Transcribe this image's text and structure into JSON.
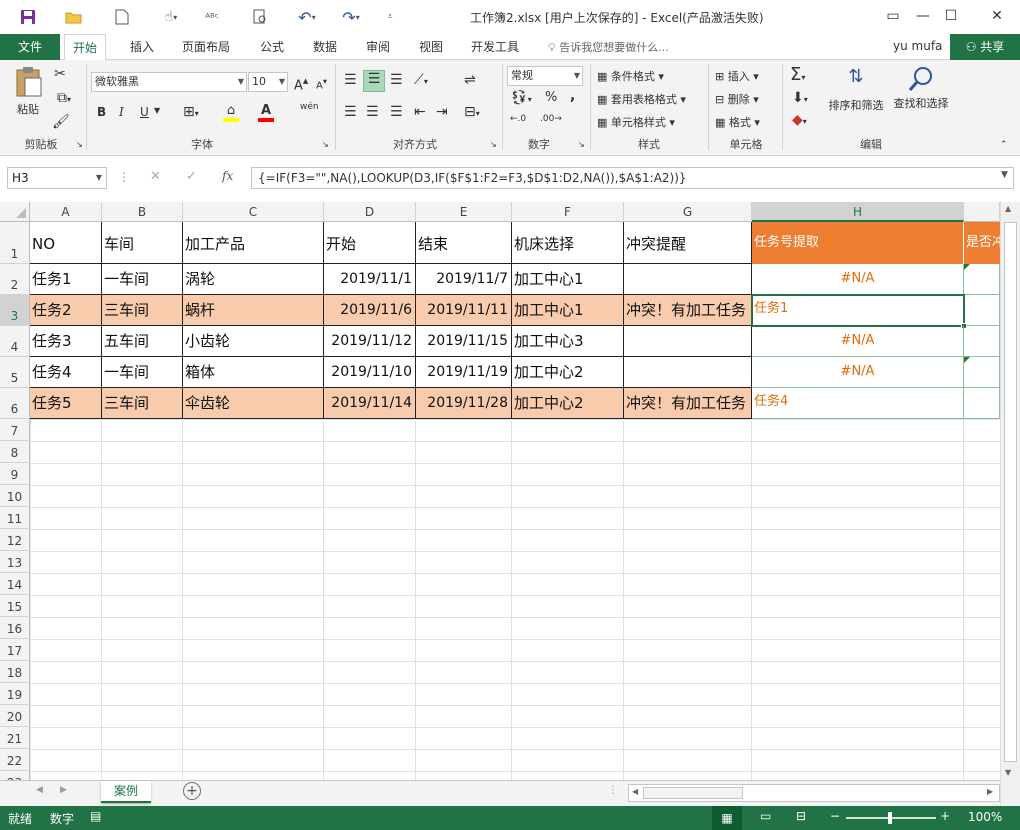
{
  "window": {
    "title": "工作簿2.xlsx [用户上次保存的] - Excel(产品激活失败)",
    "controls": [
      "restore-icon",
      "minimize-icon",
      "maximize-icon",
      "close-icon"
    ]
  },
  "tabs": {
    "file": "文件",
    "items": [
      "开始",
      "插入",
      "页面布局",
      "公式",
      "数据",
      "审阅",
      "视图",
      "开发工具"
    ],
    "active_index": 0,
    "tell_me": "告诉我您想要做什么...",
    "user": "yu mufa",
    "share": "共享"
  },
  "ribbon": {
    "clipboard": {
      "paste": "粘贴",
      "label": "剪贴板"
    },
    "font": {
      "name": "微软雅黑",
      "size": "10",
      "label": "字体",
      "bold": "B",
      "italic": "I",
      "underline": "U",
      "grow": "A",
      "shrink": "A",
      "phonetic": "wén"
    },
    "alignment": {
      "label": "对齐方式"
    },
    "number": {
      "format": "常规",
      "label": "数字",
      "percent": "%",
      "comma": ","
    },
    "styles": {
      "conditional": "条件格式",
      "table": "套用表格格式",
      "cell": "单元格样式",
      "label": "样式"
    },
    "cells": {
      "insert": "插入",
      "delete": "删除",
      "format": "格式",
      "label": "单元格"
    },
    "editing": {
      "sort": "排序和筛选",
      "find": "查找和选择",
      "label": "编辑"
    }
  },
  "formula_bar": {
    "name_box": "H3",
    "fx": "fx",
    "formula": "{=IF(F3=\"\",NA(),LOOKUP(D3,IF($F$1:F2=F3,$D$1:D2,NA()),$A$1:A2))}"
  },
  "sheet": {
    "columns": [
      "A",
      "B",
      "C",
      "D",
      "E",
      "F",
      "G",
      "H"
    ],
    "selected_column": "H",
    "selected_row": 3,
    "header": [
      "NO",
      "车间",
      "加工产品",
      "开始",
      "结束",
      "机床选择",
      "冲突提醒"
    ],
    "h_header": "任务号提取",
    "i_header": "是否冲",
    "rows": [
      {
        "no": "任务1",
        "workshop": "一车间",
        "product": "涡轮",
        "start": "2019/11/1",
        "end": "2019/11/7",
        "machine": "加工中心1",
        "conflict": "",
        "task": "#N/A"
      },
      {
        "no": "任务2",
        "workshop": "三车间",
        "product": "蜗杆",
        "start": "2019/11/6",
        "end": "2019/11/11",
        "machine": "加工中心1",
        "conflict": "冲突！有加工任务",
        "task": "任务1"
      },
      {
        "no": "任务3",
        "workshop": "五车间",
        "product": "小齿轮",
        "start": "2019/11/12",
        "end": "2019/11/15",
        "machine": "加工中心3",
        "conflict": "",
        "task": "#N/A"
      },
      {
        "no": "任务4",
        "workshop": "一车间",
        "product": "箱体",
        "start": "2019/11/10",
        "end": "2019/11/19",
        "machine": "加工中心2",
        "conflict": "",
        "task": "#N/A"
      },
      {
        "no": "任务5",
        "workshop": "三车间",
        "product": "伞齿轮",
        "start": "2019/11/14",
        "end": "2019/11/28",
        "machine": "加工中心2",
        "conflict": "冲突！有加工任务",
        "task": "任务4"
      }
    ],
    "row_numbers": [
      "1",
      "2",
      "3",
      "4",
      "5",
      "6",
      "7",
      "8",
      "9",
      "10",
      "11",
      "12",
      "13",
      "14",
      "15",
      "16",
      "17",
      "18",
      "19",
      "20",
      "21",
      "22",
      "23"
    ],
    "sheet_tab": "案例"
  },
  "status_bar": {
    "ready": "就绪",
    "mode": "数字",
    "zoom": "100%"
  },
  "colors": {
    "excel_green": "#217346",
    "orange_header": "#ed7d31",
    "pink_row": "#f8cbad",
    "orange_text": "#e46c0a"
  }
}
